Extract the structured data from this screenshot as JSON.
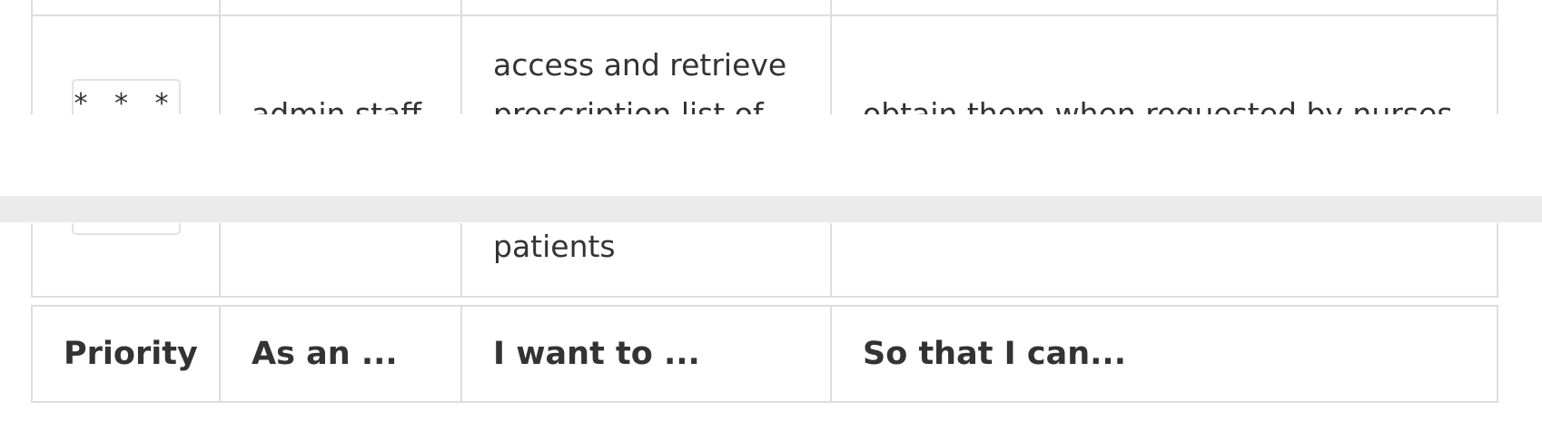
{
  "table": {
    "headers": {
      "priority": "Priority",
      "role": "As an ...",
      "want": "I want to ...",
      "benefit": "So that I can..."
    },
    "rows": [
      {
        "priority": "* * *",
        "role": "admin staff",
        "want": "access and retrieve prescription list of patients",
        "benefit": "obtain them when requested by nurses"
      }
    ]
  }
}
